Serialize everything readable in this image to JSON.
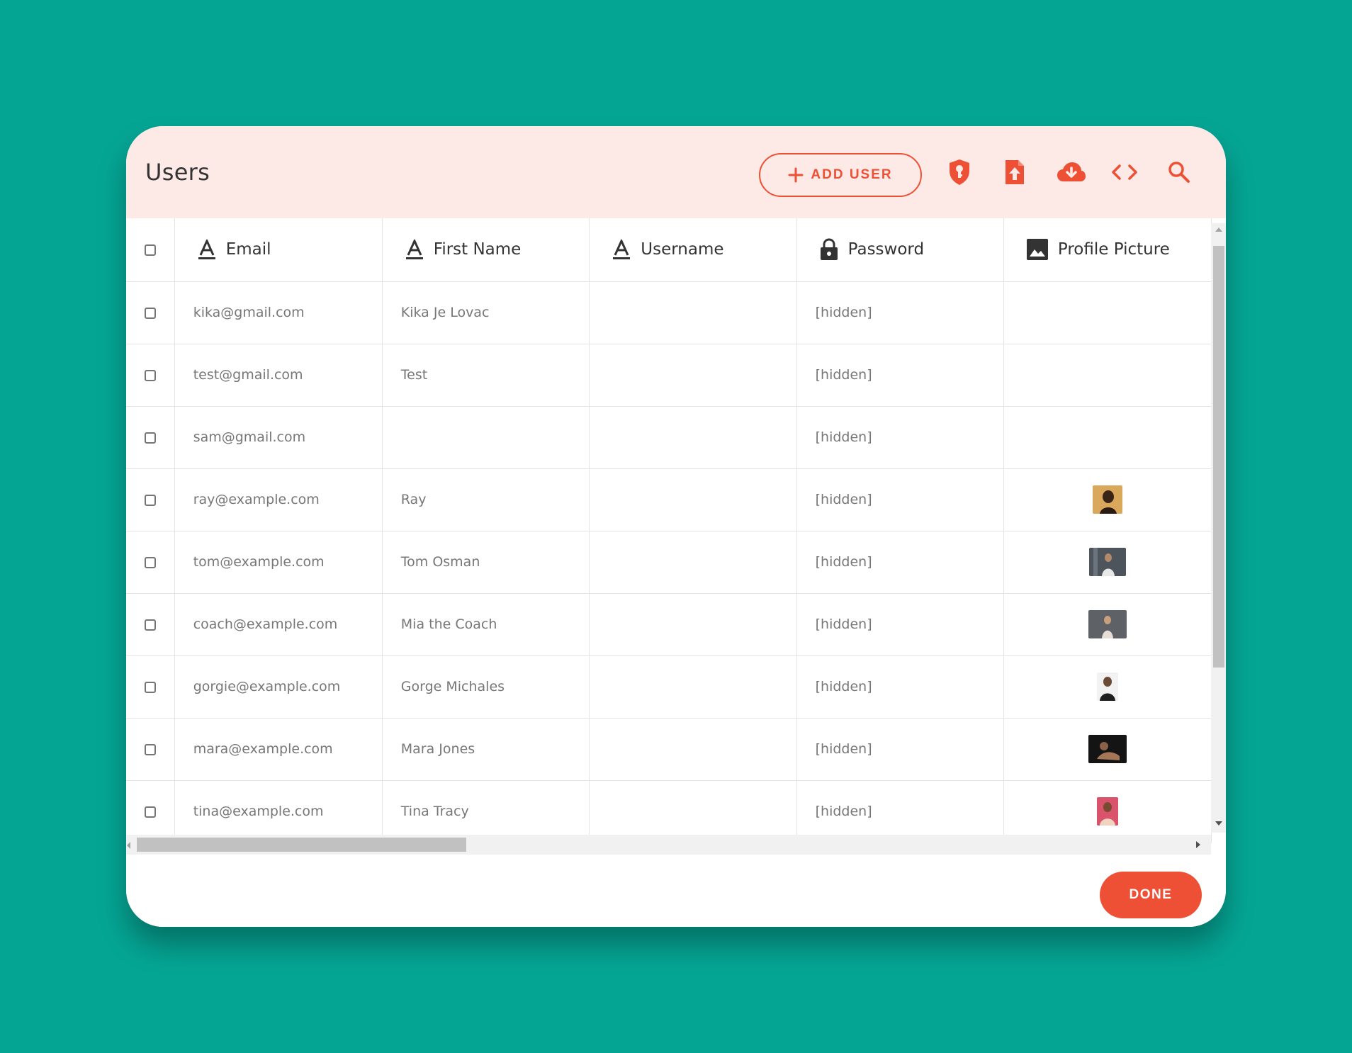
{
  "colors": {
    "background": "#05a594",
    "accent": "#ee5036",
    "header_bg": "#fde9e6"
  },
  "dialog": {
    "title": "Users",
    "toolbar": {
      "add_user_label": "ADD USER",
      "icons": [
        "shield-key-icon",
        "upload-file-icon",
        "cloud-download-icon",
        "code-icon",
        "search-icon"
      ]
    },
    "table": {
      "columns": [
        {
          "label": "Email",
          "icon": "text-field-icon"
        },
        {
          "label": "First Name",
          "icon": "text-field-icon"
        },
        {
          "label": "Username",
          "icon": "text-field-icon"
        },
        {
          "label": "Password",
          "icon": "lock-icon"
        },
        {
          "label": "Profile Picture",
          "icon": "image-icon"
        }
      ],
      "rows": [
        {
          "email": "kika@gmail.com",
          "first_name": "Kika Je Lovac",
          "username": "",
          "password": "[hidden]",
          "has_picture": false
        },
        {
          "email": "test@gmail.com",
          "first_name": "Test",
          "username": "",
          "password": "[hidden]",
          "has_picture": false
        },
        {
          "email": "sam@gmail.com",
          "first_name": "",
          "username": "",
          "password": "[hidden]",
          "has_picture": false
        },
        {
          "email": "ray@example.com",
          "first_name": "Ray",
          "username": "",
          "password": "[hidden]",
          "has_picture": true
        },
        {
          "email": "tom@example.com",
          "first_name": "Tom Osman",
          "username": "",
          "password": "[hidden]",
          "has_picture": true
        },
        {
          "email": "coach@example.com",
          "first_name": "Mia the Coach",
          "username": "",
          "password": "[hidden]",
          "has_picture": true
        },
        {
          "email": "gorgie@example.com",
          "first_name": "Gorge Michales",
          "username": "",
          "password": "[hidden]",
          "has_picture": true
        },
        {
          "email": "mara@example.com",
          "first_name": "Mara Jones",
          "username": "",
          "password": "[hidden]",
          "has_picture": true
        },
        {
          "email": "tina@example.com",
          "first_name": "Tina Tracy",
          "username": "",
          "password": "[hidden]",
          "has_picture": true
        }
      ]
    },
    "done_label": "DONE"
  }
}
